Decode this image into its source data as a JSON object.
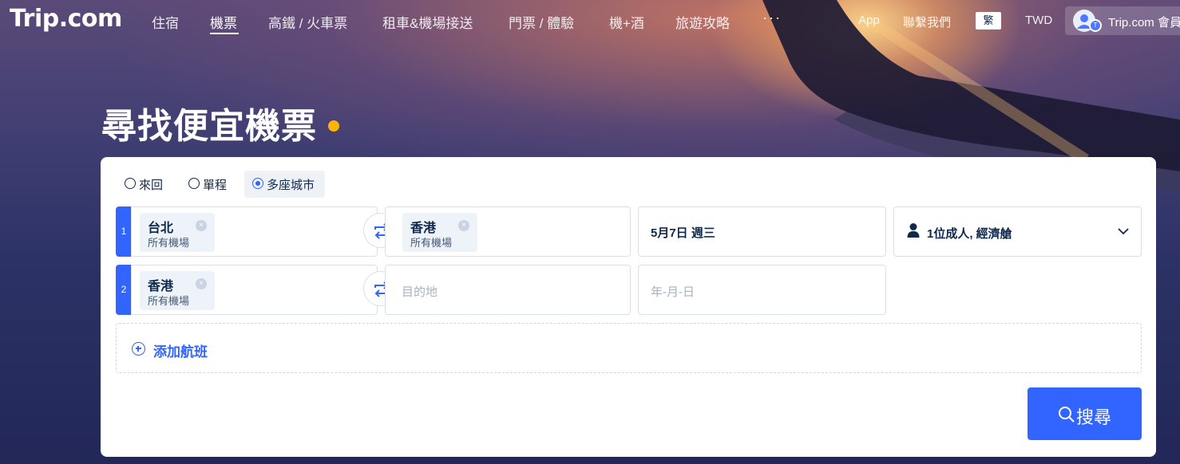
{
  "header": {
    "logo": "Trip.com",
    "nav": [
      {
        "label": "住宿"
      },
      {
        "label": "機票",
        "active": true
      },
      {
        "label": "高鐵 / 火車票"
      },
      {
        "label": "租車&機場接送"
      },
      {
        "label": "門票 / 體驗"
      },
      {
        "label": "機+酒"
      },
      {
        "label": "旅遊攻略"
      }
    ],
    "more": "···",
    "app": "App",
    "contact": "聯繫我們",
    "language": "繁",
    "currency": "TWD",
    "member": "Trip.com 會員"
  },
  "title": "尋找便宜機票",
  "trip_types": [
    {
      "label": "來回",
      "selected": false
    },
    {
      "label": "單程",
      "selected": false
    },
    {
      "label": "多座城市",
      "selected": true
    }
  ],
  "segments": [
    {
      "index": "1",
      "from": {
        "city": "台北",
        "sub": "所有機場"
      },
      "to": {
        "city": "香港",
        "sub": "所有機場"
      },
      "date": "5月7日 週三"
    },
    {
      "index": "2",
      "from": {
        "city": "香港",
        "sub": "所有機場"
      },
      "to_placeholder": "目的地",
      "date_placeholder": "年-月-日"
    }
  ],
  "passengers": "1位成人, 經濟艙",
  "add_flight": "添加航班",
  "search": "搜尋",
  "colors": {
    "primary": "#3264ff",
    "text": "#0f294d",
    "accent_dot": "#ffb400"
  }
}
